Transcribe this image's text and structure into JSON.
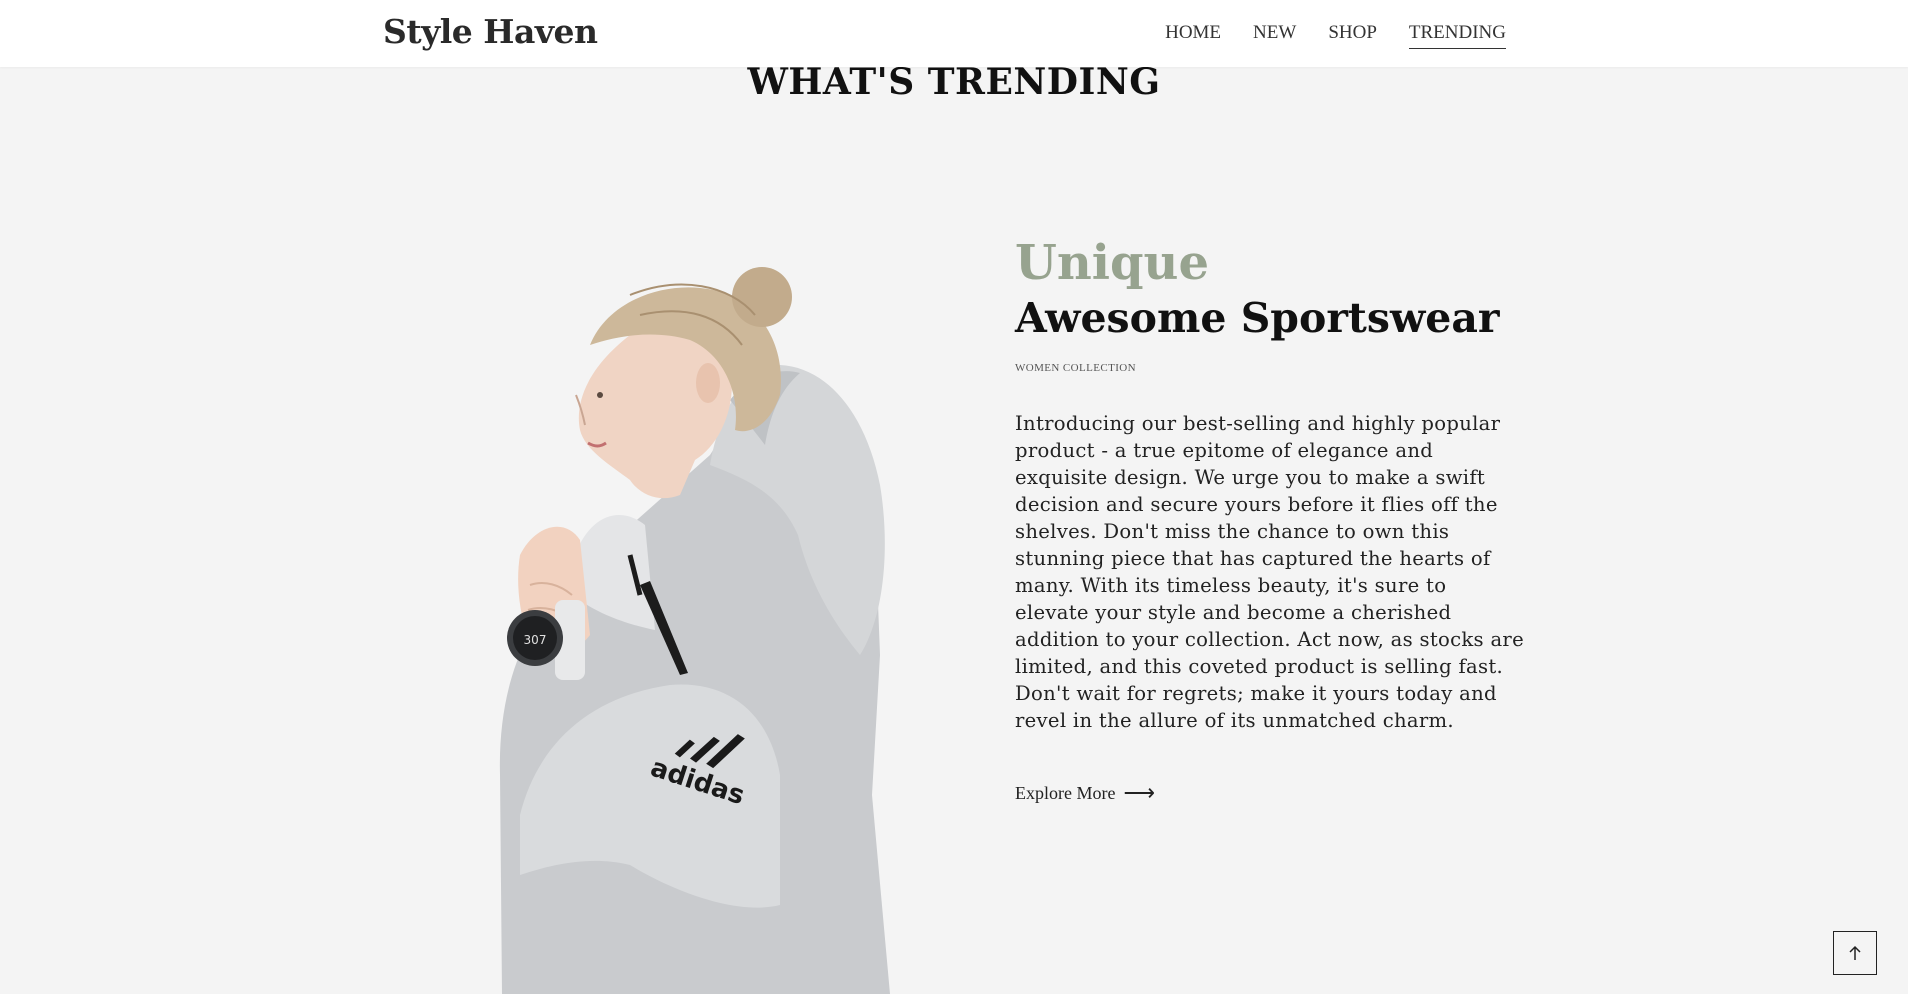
{
  "header": {
    "brand": "Style Haven",
    "nav": [
      "HOME",
      "NEW",
      "SHOP",
      "TRENDING"
    ],
    "active_nav": "TRENDING"
  },
  "section": {
    "title": "WHAT'S TRENDING"
  },
  "feature": {
    "kicker": "Unique",
    "headline": "Awesome Sportswear",
    "collection": "WOMEN COLLECTION",
    "description": "Introducing our best-selling and highly popular product - a true epitome of elegance and exquisite design. We urge you to make a swift decision and secure yours before it flies off the shelves. Don't miss the chance to own this stunning piece that has captured the hearts of many. With its timeless beauty, it's sure to elevate your style and become a cherished addition to your collection. Act now, as stocks are limited, and this coveted product is selling fast. Don't wait for regrets; make it yours today and revel in the allure of its unmatched charm.",
    "cta_label": "Explore More",
    "cta_icon": "arrow-right-icon",
    "image_logo_text": "adidas",
    "watch_display": "307"
  },
  "back_to_top": {
    "icon": "arrow-up-icon"
  },
  "colors": {
    "background": "#f4f4f4",
    "header_bg": "#ffffff",
    "accent": "#97a38f",
    "text": "#111111"
  }
}
